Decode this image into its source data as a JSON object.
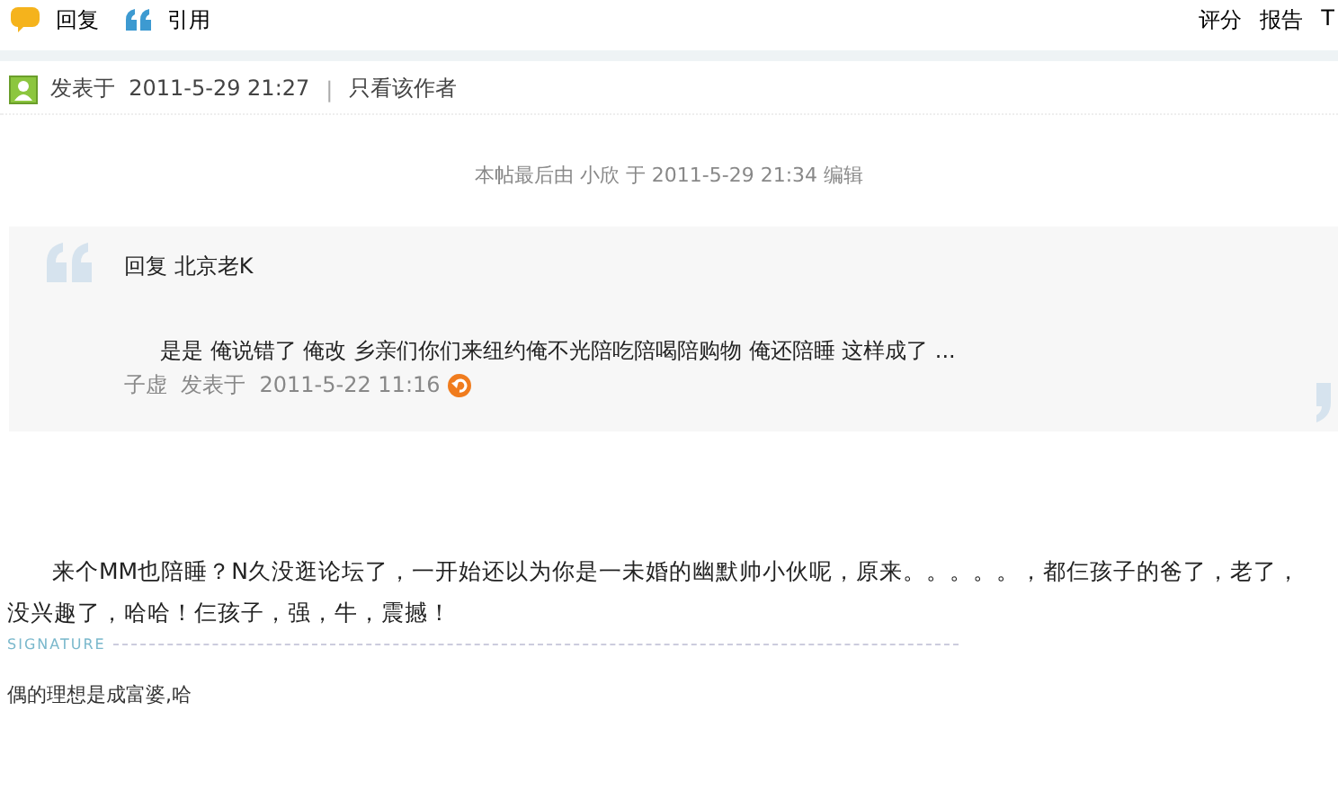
{
  "toolbar": {
    "left": [
      {
        "kind": "reply",
        "label": "回复"
      },
      {
        "kind": "quote",
        "label": "引用"
      }
    ],
    "right": [
      "评分",
      "报告",
      "T"
    ]
  },
  "post_header": {
    "posted_label": "发表于",
    "time": "2011-5-29 21:27",
    "separator": "|",
    "author_only": "只看该作者"
  },
  "edit_note": "本帖最后由 小欣 于 2011-5-29 21:34 编辑",
  "quote": {
    "reply_to": "回复  北京老K",
    "text": "是是  俺说错了   俺改  乡亲们你们来纽约俺不光陪吃陪喝陪购物  俺还陪睡  这样成了  ...",
    "author": "子虚",
    "posted_label": "发表于",
    "time": "2011-5-22 11:16"
  },
  "body": "来个MM也陪睡？N久没逛论坛了，一开始还以为你是一未婚的幽默帅小伙呢，原来。。。。。，都仨孩子的爸了，老了，没兴趣了，哈哈！仨孩子，强，牛，震撼！",
  "signature": {
    "label": "SIGNATURE",
    "text": "偶的理想是成富婆,哈"
  }
}
